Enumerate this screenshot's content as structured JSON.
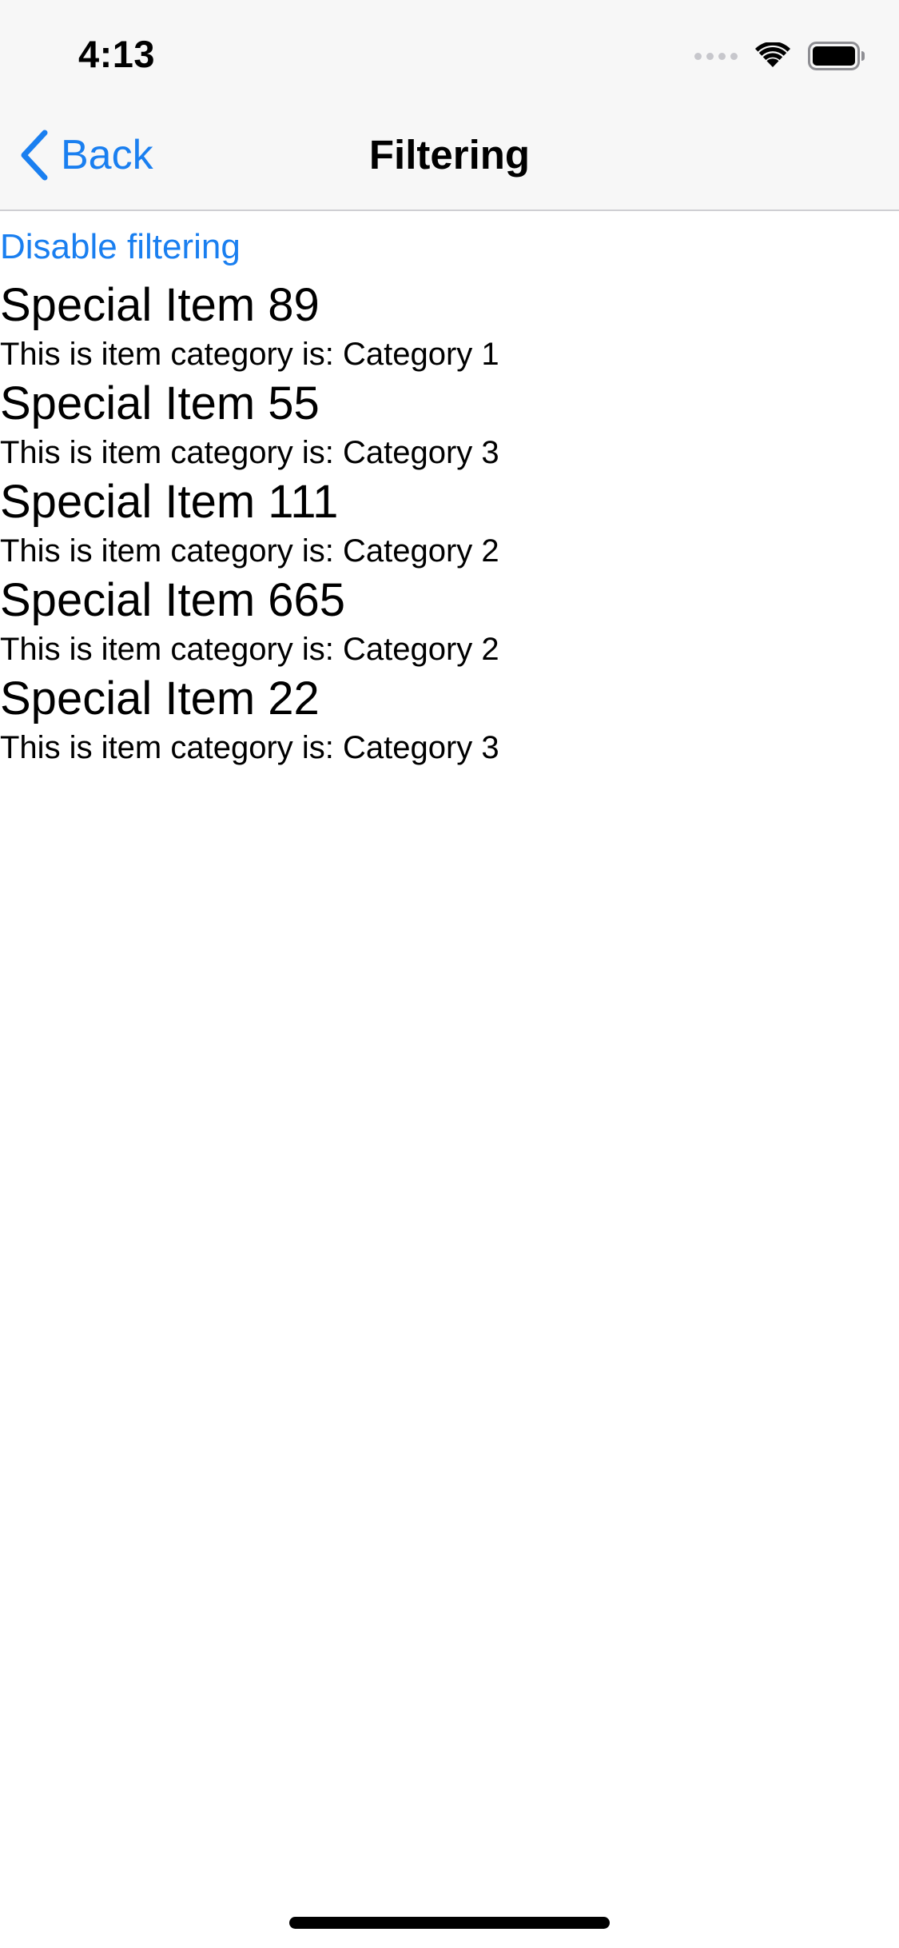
{
  "status_bar": {
    "time": "4:13",
    "icons": [
      "signal-dots-icon",
      "wifi-icon",
      "battery-icon"
    ]
  },
  "nav_bar": {
    "back_label": "Back",
    "title": "Filtering"
  },
  "colors": {
    "accent": "#1a7ff0",
    "bar_background": "#f7f7f7"
  },
  "filter_toggle": {
    "label": "Disable filtering"
  },
  "items": [
    {
      "title": "Special Item 89",
      "subtitle": "This is item category is: Category 1"
    },
    {
      "title": "Special Item 55",
      "subtitle": "This is item category is: Category 3"
    },
    {
      "title": "Special Item 111",
      "subtitle": "This is item category is: Category 2"
    },
    {
      "title": "Special Item 665",
      "subtitle": "This is item category is: Category 2"
    },
    {
      "title": "Special Item 22",
      "subtitle": "This is item category is: Category 3"
    }
  ]
}
